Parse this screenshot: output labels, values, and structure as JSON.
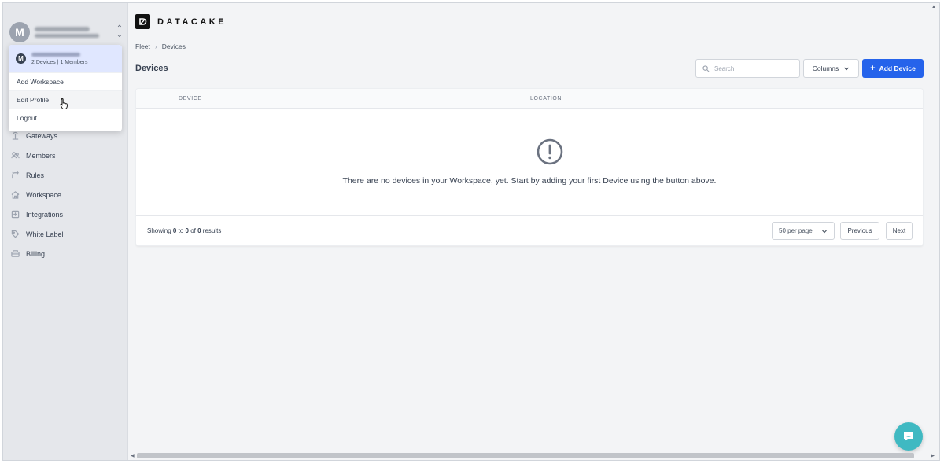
{
  "sidebar": {
    "workspace_avatar": "M",
    "dropdown": {
      "workspace_avatar": "M",
      "workspace_meta": "2 Devices  |  1 Members",
      "items": [
        "Add Workspace",
        "Edit Profile",
        "Logout"
      ]
    },
    "nav": [
      {
        "label": "Gateways",
        "icon": "gateway-icon"
      },
      {
        "label": "Members",
        "icon": "users-icon"
      },
      {
        "label": "Rules",
        "icon": "rules-icon"
      },
      {
        "label": "Workspace",
        "icon": "home-icon"
      },
      {
        "label": "Integrations",
        "icon": "integration-icon"
      },
      {
        "label": "White Label",
        "icon": "tag-icon"
      },
      {
        "label": "Billing",
        "icon": "billing-icon"
      }
    ]
  },
  "header": {
    "logo_text": "DATACAKE",
    "breadcrumb": [
      "Fleet",
      "Devices"
    ],
    "title": "Devices"
  },
  "toolbar": {
    "search_placeholder": "Search",
    "columns_label": "Columns",
    "add_label": "Add Device",
    "accent": "#2563eb"
  },
  "table": {
    "columns": [
      "DEVICE",
      "LOCATION"
    ],
    "empty_message": "There are no devices in your Workspace, yet. Start by adding your first Device using the button above."
  },
  "pagination": {
    "showing_prefix": "Showing",
    "from": "0",
    "to_word": "to",
    "to": "0",
    "of_word": "of",
    "total": "0",
    "results_word": "results",
    "per_page": "50 per page",
    "previous_label": "Previous",
    "next_label": "Next"
  }
}
